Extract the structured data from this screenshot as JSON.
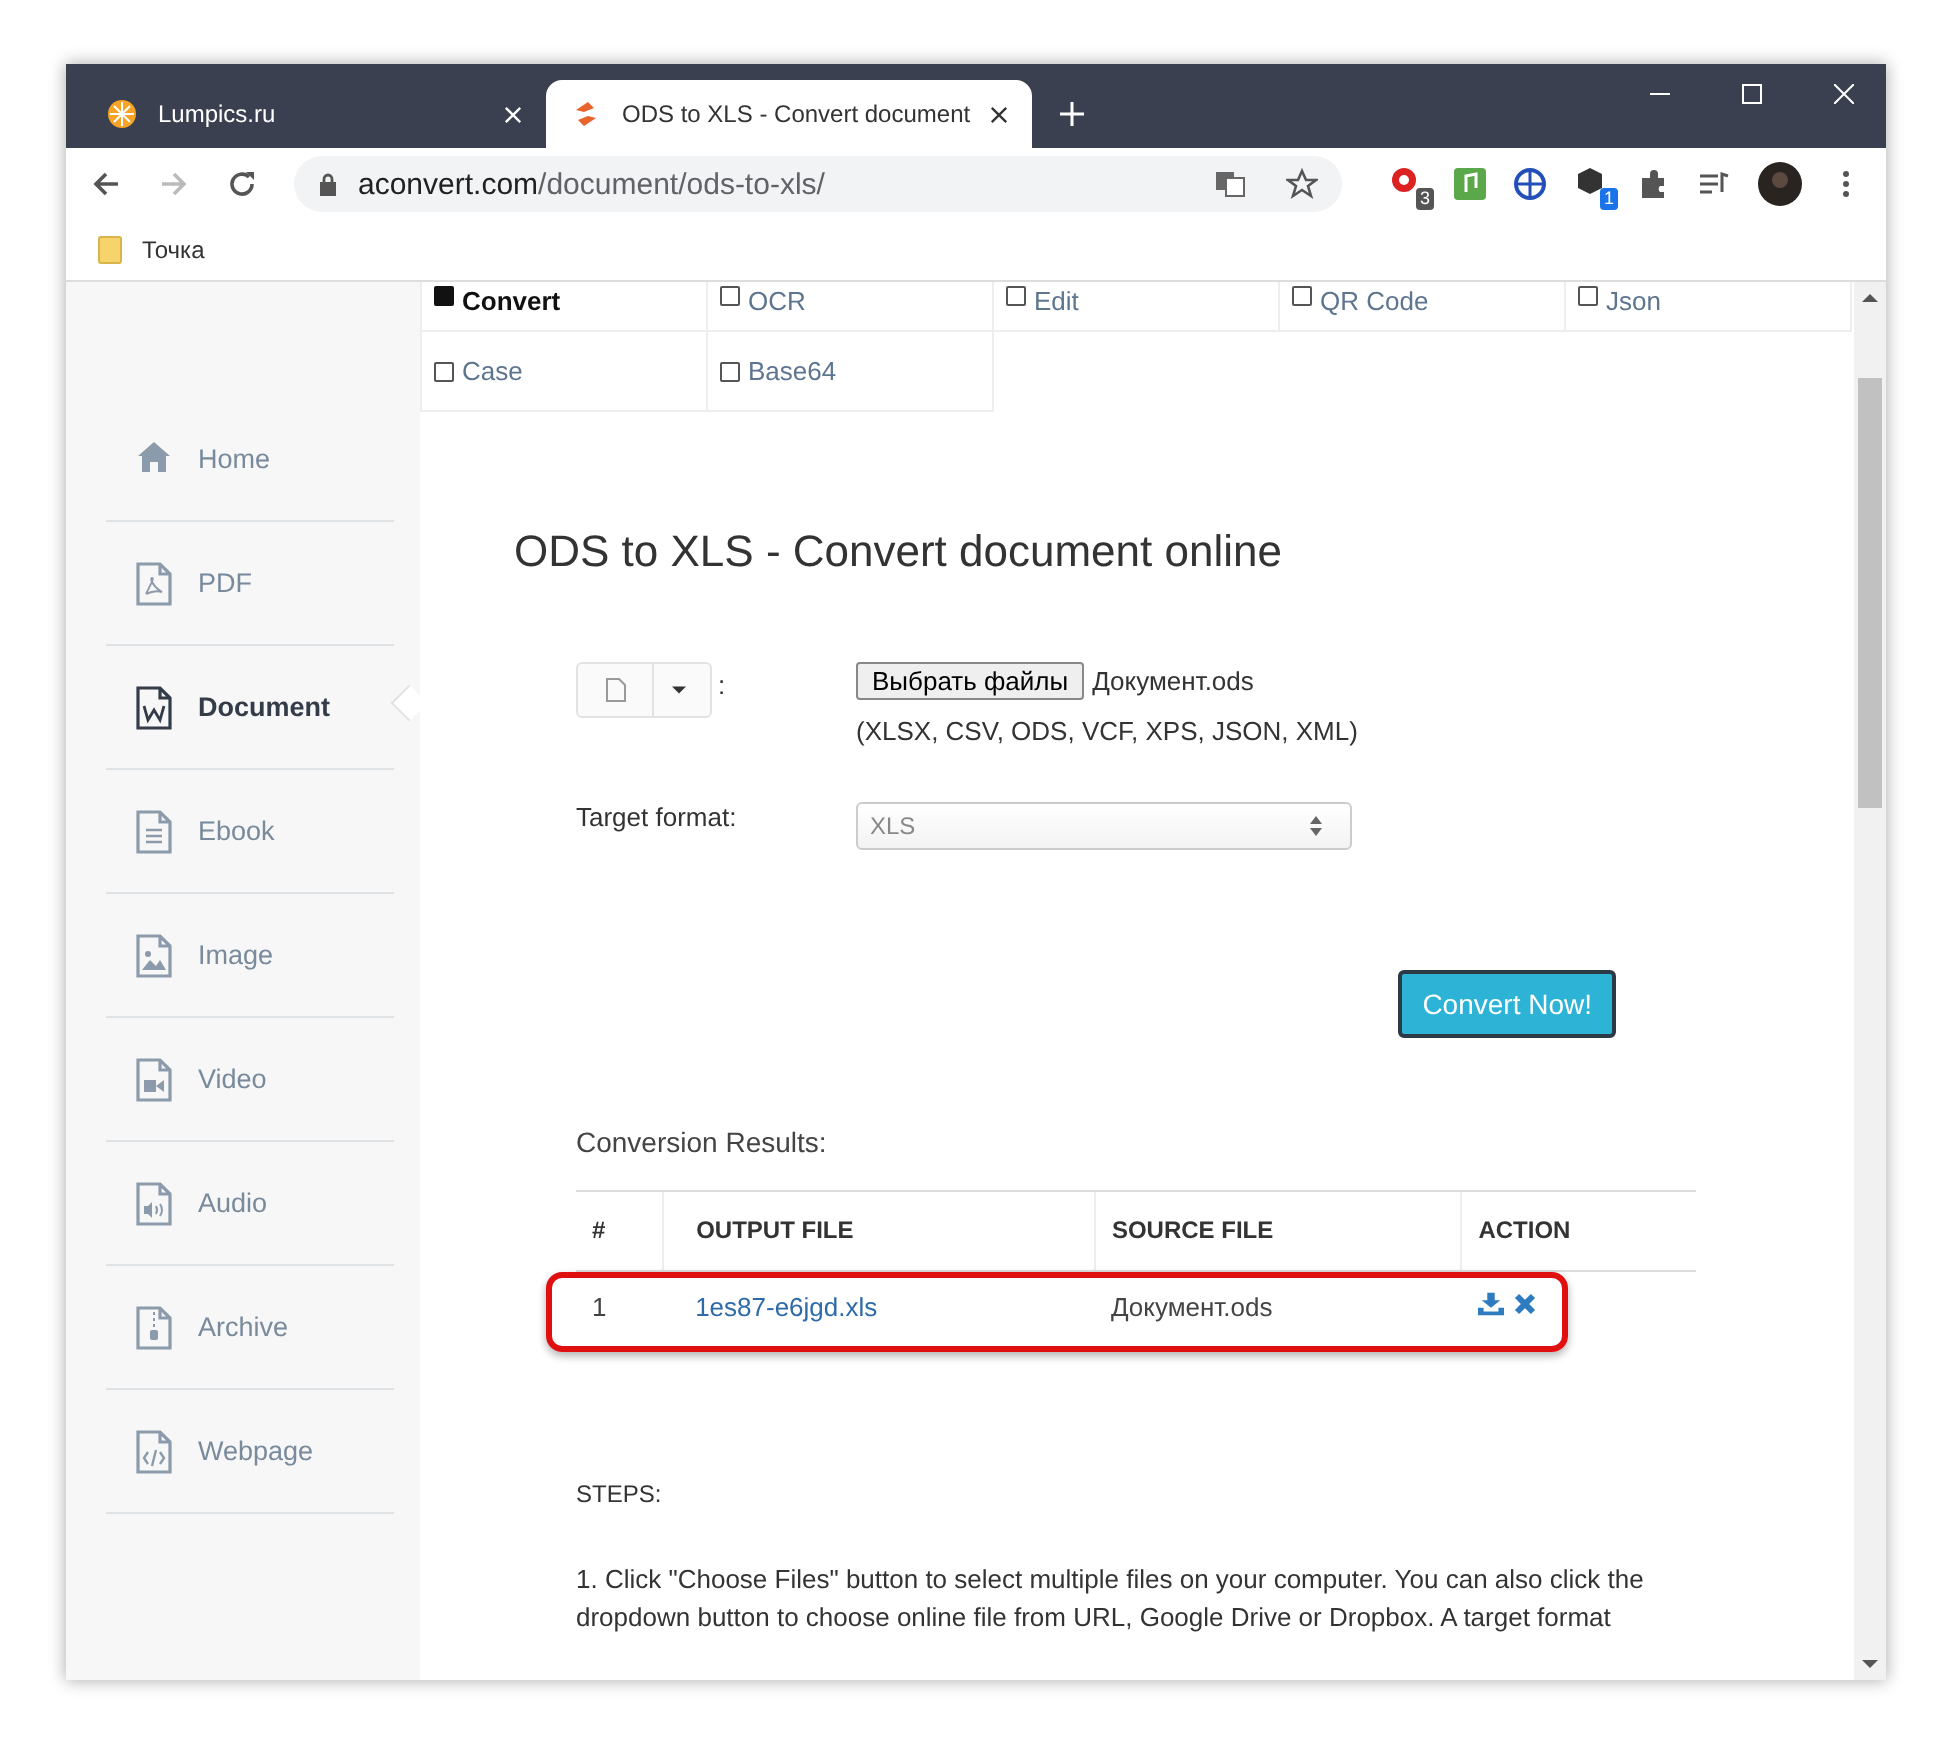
{
  "browser": {
    "tabs": [
      {
        "title": "Lumpics.ru",
        "selected": false
      },
      {
        "title": "ODS to XLS - Convert document",
        "selected": true
      }
    ],
    "address": {
      "domain": "aconvert.com",
      "path": "/document/ods-to-xls/"
    },
    "extension_badges": [
      "3",
      "1"
    ],
    "bookmarks": [
      "Точка"
    ]
  },
  "categories": [
    {
      "label": "Convert",
      "selected": true
    },
    {
      "label": "OCR",
      "selected": false
    },
    {
      "label": "Edit",
      "selected": false
    },
    {
      "label": "QR Code",
      "selected": false
    },
    {
      "label": "Json",
      "selected": false
    },
    {
      "label": "Case",
      "selected": false
    },
    {
      "label": "Base64",
      "selected": false
    }
  ],
  "sidebar": {
    "items": [
      {
        "label": "Home",
        "kind": "home",
        "selected": false
      },
      {
        "label": "PDF",
        "kind": "pdf",
        "selected": false
      },
      {
        "label": "Document",
        "kind": "document",
        "selected": true
      },
      {
        "label": "Ebook",
        "kind": "ebook",
        "selected": false
      },
      {
        "label": "Image",
        "kind": "image",
        "selected": false
      },
      {
        "label": "Video",
        "kind": "video",
        "selected": false
      },
      {
        "label": "Audio",
        "kind": "audio",
        "selected": false
      },
      {
        "label": "Archive",
        "kind": "archive",
        "selected": false
      },
      {
        "label": "Webpage",
        "kind": "webpage",
        "selected": false
      }
    ]
  },
  "title": "ODS to XLS - Convert document online",
  "file_input": {
    "colon": ":",
    "button": "Выбрать файлы",
    "file_name": "Документ.ods",
    "formats": "(XLSX, CSV, ODS, VCF, XPS, JSON, XML)"
  },
  "target_format": {
    "label": "Target format:",
    "value": "XLS"
  },
  "convert_button": "Convert Now!",
  "results": {
    "title": "Conversion Results:",
    "columns": [
      "#",
      "OUTPUT FILE",
      "SOURCE FILE",
      "ACTION"
    ],
    "rows": [
      {
        "index": "1",
        "output": "1es87-e6jgd.xls",
        "source": "Документ.ods",
        "highlighted": true
      }
    ]
  },
  "steps": {
    "title": "STEPS:",
    "text": "1. Click \"Choose Files\" button to select multiple files on your computer. You can also click the dropdown button to choose online file from URL, Google Drive or Dropbox. A target format"
  }
}
